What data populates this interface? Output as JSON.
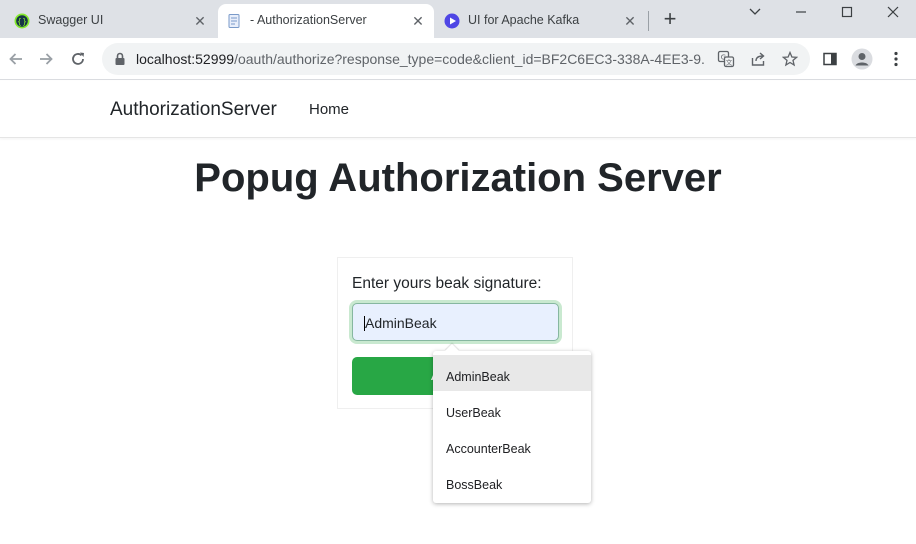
{
  "window": {
    "controls": [
      "dropdown",
      "minimize",
      "maximize",
      "close"
    ]
  },
  "tabs": [
    {
      "title": "Swagger UI",
      "icon": "swagger-icon",
      "active": false
    },
    {
      "title": "- AuthorizationServer",
      "icon": "document-icon",
      "active": true
    },
    {
      "title": "UI for Apache Kafka",
      "icon": "kafka-ui-icon",
      "active": false
    }
  ],
  "toolbar": {
    "url_host": "localhost:52999",
    "url_path": "/oauth/authorize?response_type=code&client_id=BF2C6EC3-338A-4EE3-9..."
  },
  "page": {
    "brand": "AuthorizationServer",
    "nav_home": "Home",
    "title": "Popug Authorization Server"
  },
  "form": {
    "label": "Enter yours beak signature:",
    "input_value": "AdminBeak",
    "accept_label": "Accept"
  },
  "autocomplete": {
    "options": [
      "AdminBeak",
      "UserBeak",
      "AccounterBeak",
      "BossBeak"
    ],
    "selected": "AdminBeak"
  },
  "colors": {
    "accent_green": "#28a745",
    "tabstrip": "#dee1e6",
    "input_autofill": "#e8f0fe"
  }
}
